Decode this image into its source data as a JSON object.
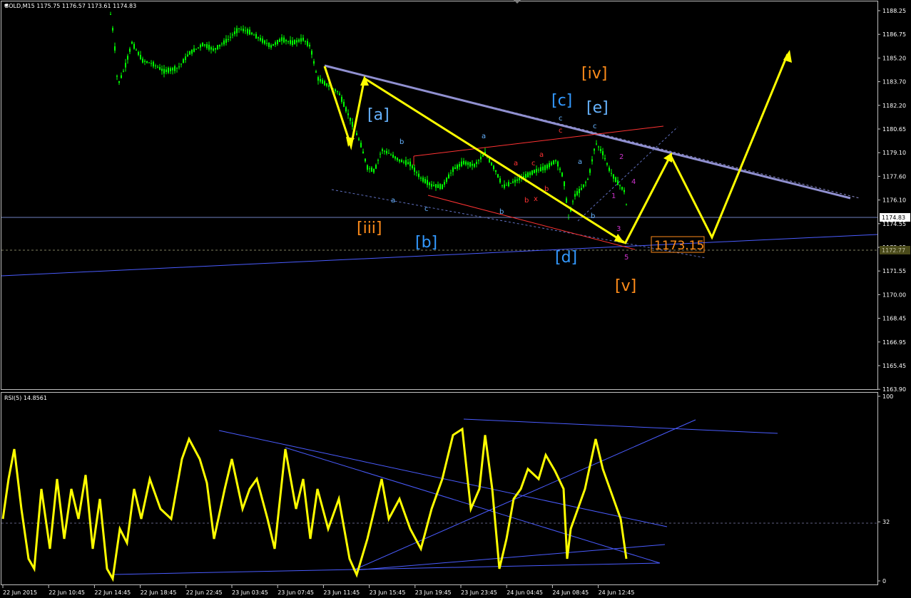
{
  "symbol_header": "GOLD,M15  1175.75 1176.57 1173.61 1174.83",
  "rsi_header": "RSI(5) 14.8561",
  "current_price_label": "1174.83",
  "dotted_level_label": "1172.77",
  "target_label": "1173.15",
  "colors": {
    "background": "#000000",
    "candle": "#00ff00",
    "grid": "#c0c0c0",
    "wave_orange": "#ff8c1a",
    "wave_blue": "#3399ff",
    "wave_lightblue": "#66b3ff",
    "wave_red": "#ff3333",
    "wave_magenta": "#cc33cc",
    "projection_yellow": "#ffff00",
    "trendline_gray": "#9090d0",
    "trendline_blue": "#4a5cff",
    "rsi_line": "#ffff00"
  },
  "chart_data": [
    {
      "type": "candlestick",
      "title": "GOLD,M15",
      "ohlc_last": {
        "open": 1175.75,
        "high": 1176.57,
        "low": 1173.61,
        "close": 1174.83
      },
      "price_axis_ticks": [
        "1188.25",
        "1186.75",
        "1185.20",
        "1183.70",
        "1182.20",
        "1180.65",
        "1179.10",
        "1177.60",
        "1176.10",
        "1174.55",
        "1173.05",
        "1171.55",
        "1170.00",
        "1168.45",
        "1166.95",
        "1165.45",
        "1163.90"
      ],
      "time_axis_ticks": [
        "22 Jun 2015",
        "22 Jun 10:45",
        "22 Jun 14:45",
        "22 Jun 18:45",
        "22 Jun 22:45",
        "23 Jun 03:45",
        "23 Jun 07:45",
        "23 Jun 11:45",
        "23 Jun 15:45",
        "23 Jun 19:45",
        "23 Jun 23:45",
        "24 Jun 04:45",
        "24 Jun 08:45",
        "24 Jun 12:45"
      ],
      "wave_labels": [
        {
          "text": "[iii]",
          "color": "orange"
        },
        {
          "text": "[iv]",
          "color": "orange"
        },
        {
          "text": "[v]",
          "color": "orange"
        },
        {
          "text": "[a]",
          "color": "lightblue"
        },
        {
          "text": "[b]",
          "color": "blue"
        },
        {
          "text": "[c]",
          "color": "blue"
        },
        {
          "text": "[d]",
          "color": "blue"
        },
        {
          "text": "[e]",
          "color": "lightblue"
        }
      ],
      "minor_labels": [
        "a",
        "b",
        "c",
        "a",
        "b",
        "c",
        "a",
        "b",
        "c",
        "a",
        "b",
        "c",
        "x",
        "a",
        "b",
        "c",
        "1",
        "2",
        "3",
        "4",
        "5"
      ],
      "current_price": 1174.83,
      "target_price": 1173.15,
      "dotted_level": 1172.77
    },
    {
      "type": "line",
      "title": "RSI(5)",
      "last_value": 14.8561,
      "axis_ticks": [
        "100",
        "32",
        "0"
      ],
      "level": 32,
      "ylim": [
        0,
        100
      ]
    }
  ]
}
